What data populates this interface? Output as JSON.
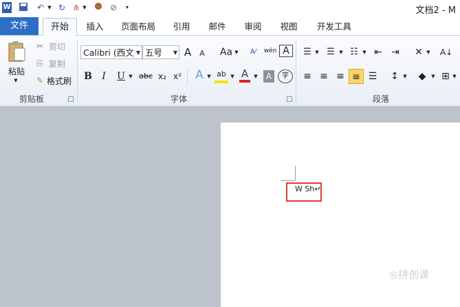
{
  "window": {
    "title": "文档2 - M"
  },
  "qat": {
    "icons": [
      "word-logo-icon",
      "save-icon",
      "undo-icon",
      "redo-icon",
      "format-icon",
      "color-icon",
      "no-icon",
      "customize-icon"
    ]
  },
  "tabs": {
    "file": "文件",
    "home": "开始",
    "insert": "插入",
    "layout": "页面布局",
    "references": "引用",
    "mailings": "邮件",
    "review": "审阅",
    "view": "视图",
    "developer": "开发工具"
  },
  "clipboard": {
    "paste": "粘贴",
    "cut": "剪切",
    "copy": "复制",
    "format_painter": "格式刷",
    "group": "剪贴板"
  },
  "font": {
    "name": "Calibri (西文",
    "size": "五号",
    "group": "字体",
    "grow": "A",
    "shrink": "A",
    "case": "Aa",
    "wen": "wén",
    "bold": "B",
    "italic": "I",
    "underline": "U",
    "strike": "abc",
    "subscript": "x₂",
    "superscript": "x²",
    "highlight": "ab",
    "font_color": "A",
    "shade": "A",
    "enclose": "字"
  },
  "paragraph": {
    "group": "段落"
  },
  "document": {
    "text": "W Sh↵"
  },
  "watermark": "◎拼创课"
}
